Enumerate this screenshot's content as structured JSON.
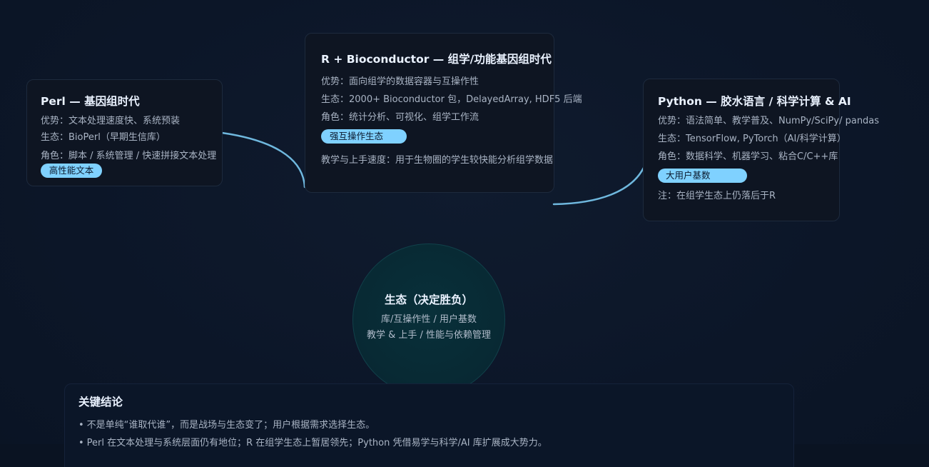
{
  "cards": {
    "perl": {
      "title": "Perl — 基因组时代",
      "lines": [
        "优势：文本处理速度快、系统预装",
        "生态：BioPerl（早期生信库）",
        "角色：脚本 / 系统管理 / 快速拼接文本处理"
      ],
      "tag": "高性能文本"
    },
    "r": {
      "title": "R + Bioconductor — 组学/功能基因组时代",
      "lines": [
        "优势：面向组学的数据容器与互操作性",
        "生态：2000+ Bioconductor 包，DelayedArray, HDF5 后端",
        "角色：统计分析、可视化、组学工作流"
      ],
      "tag": "强互操作生态",
      "note": "教学与上手速度：用于生物圈的学生较快能分析组学数据"
    },
    "python": {
      "title": "Python — 胶水语言 / 科学计算 & AI",
      "lines": [
        "优势：语法简单、教学普及、NumPy/SciPy/ pandas",
        "生态：TensorFlow, PyTorch（AI/科学计算）",
        "角色：数据科学、机器学习、粘合C/C++库"
      ],
      "tag": "大用户基数",
      "note": "注：在组学生态上仍落后于R"
    }
  },
  "center": {
    "title": "生态（决定胜负）",
    "line1": "库/互操作性 / 用户基数",
    "line2": "教学 & 上手 / 性能与依赖管理"
  },
  "conclusion": {
    "title": "关键结论",
    "bullets": [
      "不是单纯“谁取代谁”，而是战场与生态变了；用户根据需求选择生态。",
      "Perl 在文本处理与系统层面仍有地位；R 在组学生态上暂居领先；Python 凭借易学与科学/AI 库扩展成大势力。"
    ],
    "bullet_char": "•"
  },
  "colors": {
    "background": "#0c1628",
    "card": "#0e1522",
    "connector": "#6fb8de",
    "tag": "#7fd1ff",
    "circle": "#082a34"
  }
}
